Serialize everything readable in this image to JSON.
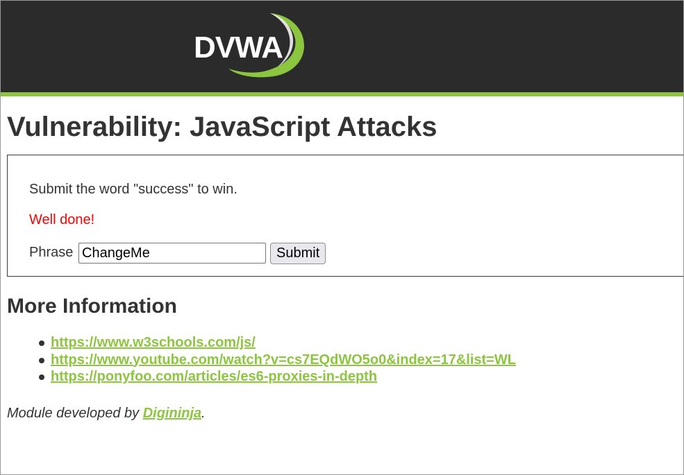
{
  "header": {
    "logo_text": "DVWA",
    "colors": {
      "background": "#2b2b2b",
      "accent": "#8cc63f"
    }
  },
  "page": {
    "title": "Vulnerability: JavaScript Attacks"
  },
  "vulnerable_area": {
    "instruction": "Submit the word \"success\" to win.",
    "result_message": "Well done!",
    "result_color": "#ff0000",
    "phrase_label": "Phrase",
    "phrase_value": "ChangeMe",
    "submit_label": "Submit"
  },
  "more_info": {
    "title": "More Information",
    "links": [
      {
        "text": "https://www.w3schools.com/js/"
      },
      {
        "text": "https://www.youtube.com/watch?v=cs7EQdWO5o0&index=17&list=WL"
      },
      {
        "text": "https://ponyfoo.com/articles/es6-proxies-in-depth"
      }
    ]
  },
  "credit": {
    "prefix": "Module developed by ",
    "author": "Digininja",
    "suffix": "."
  }
}
